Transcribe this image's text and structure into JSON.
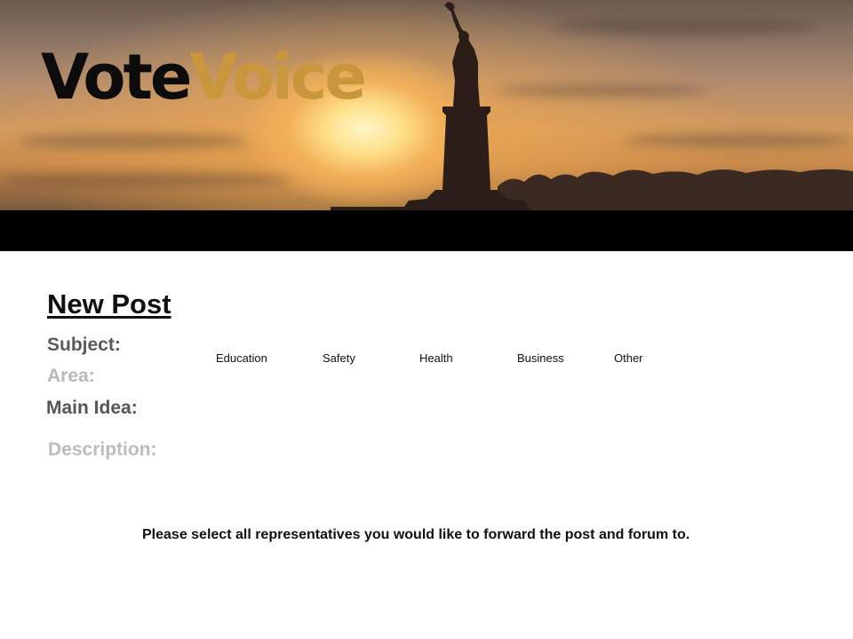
{
  "header": {
    "logo_part1": "Vote",
    "logo_part2": "Voice"
  },
  "form": {
    "title": "New Post",
    "subject_label": "Subject:",
    "area_label": "Area:",
    "area_options": [
      "Education",
      "Safety",
      "Health",
      "Business",
      "Other"
    ],
    "main_idea_label": "Main Idea:",
    "description_label": "Description:",
    "instruction": "Please select all representatives you would like to forward the post and forum to."
  },
  "colors": {
    "logo_dark": "#0c0c0c",
    "logo_gold": "#c9963c",
    "bar": "#000000"
  }
}
